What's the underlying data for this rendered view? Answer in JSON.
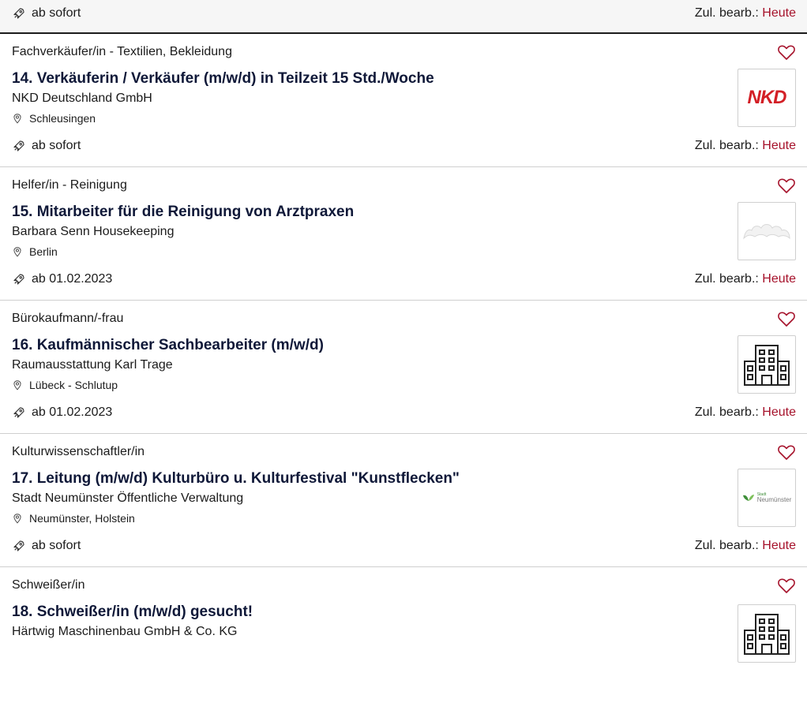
{
  "colors": {
    "accent": "#a6122b",
    "title": "#0f1838",
    "border": "#cfcfcf"
  },
  "top": {
    "start": "ab sofort",
    "zul_label": "Zul. bearb.:",
    "zul_value": "Heute"
  },
  "jobs": [
    {
      "category": "Fachverkäufer/in - Textilien, Bekleidung",
      "title": "14. Verkäuferin / Verkäufer (m/w/d) in Teilzeit 15 Std./Woche",
      "company": "NKD Deutschland GmbH",
      "location": "Schleusingen",
      "start": "ab sofort",
      "zul_label": "Zul. bearb.:",
      "zul_value": "Heute",
      "logo_text": "NKD"
    },
    {
      "category": "Helfer/in - Reinigung",
      "title": "15. Mitarbeiter für die Reinigung von Arztpraxen",
      "company": "Barbara Senn Housekeeping",
      "location": "Berlin",
      "start": "ab 01.02.2023",
      "zul_label": "Zul. bearb.:",
      "zul_value": "Heute"
    },
    {
      "category": "Bürokaufmann/-frau",
      "title": "16. Kaufmännischer Sachbearbeiter (m/w/d)",
      "company": "Raumausstattung Karl Trage",
      "location": "Lübeck - Schlutup",
      "start": "ab 01.02.2023",
      "zul_label": "Zul. bearb.:",
      "zul_value": "Heute"
    },
    {
      "category": "Kulturwissenschaftler/in",
      "title": "17. Leitung (m/w/d) Kulturbüro u. Kulturfestival \"Kunstflecken\"",
      "company": "Stadt Neumünster Öffentliche Verwaltung",
      "location": "Neumünster, Holstein",
      "start": "ab sofort",
      "zul_label": "Zul. bearb.:",
      "zul_value": "Heute",
      "logo_text_small": "Stadt",
      "logo_text": "Neumünster"
    },
    {
      "category": "Schweißer/in",
      "title": "18. Schweißer/in (m/w/d) gesucht!",
      "company": "Härtwig Maschinenbau GmbH & Co. KG"
    }
  ]
}
